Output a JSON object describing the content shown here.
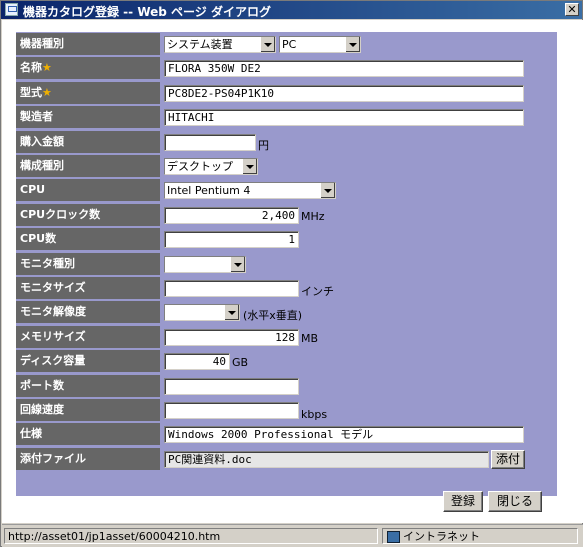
{
  "window": {
    "title": "機器カタログ登録 -- Web ページ ダイアログ",
    "close_glyph": "✕"
  },
  "form": {
    "fields": [
      {
        "label": "機器種別",
        "select1": "システム装置",
        "select2": "PC"
      },
      {
        "label": "名称",
        "required_mark": "★",
        "value": "FLORA 350W DE2"
      },
      {
        "label": "型式",
        "required_mark": "★",
        "value": "PC8DE2-PS04P1K10"
      },
      {
        "label": "製造者",
        "value": "HITACHI"
      },
      {
        "label": "購入金額",
        "value": "",
        "unit": "円"
      },
      {
        "label": "構成種別",
        "select": "デスクトップ"
      },
      {
        "label": "CPU",
        "select": "Intel Pentium 4"
      },
      {
        "label": "CPUクロック数",
        "value": "2,400",
        "unit": "MHz"
      },
      {
        "label": "CPU数",
        "value": "1"
      },
      {
        "label": "モニタ種別",
        "select": ""
      },
      {
        "label": "モニタサイズ",
        "value": "",
        "unit": "インチ"
      },
      {
        "label": "モニタ解像度",
        "select": "",
        "unit": "(水平x垂直)"
      },
      {
        "label": "メモリサイズ",
        "value": "128",
        "unit": "MB"
      },
      {
        "label": "ディスク容量",
        "value": "40",
        "unit": "GB"
      },
      {
        "label": "ポート数",
        "value": ""
      },
      {
        "label": "回線速度",
        "value": "",
        "unit": "kbps"
      },
      {
        "label": "仕様",
        "value": "Windows 2000 Professional モデル"
      },
      {
        "label": "添付ファイル",
        "value": "PC関連資料.doc",
        "button": "添付"
      }
    ]
  },
  "buttons": {
    "register": "登録",
    "close": "閉じる"
  },
  "statusbar": {
    "url": "http://asset01/jp1asset/60004210.htm",
    "zone": "イントラネット"
  }
}
